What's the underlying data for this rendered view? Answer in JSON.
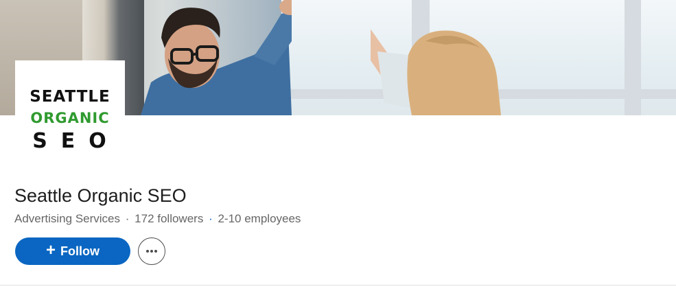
{
  "company": {
    "name": "Seattle Organic SEO",
    "industry": "Advertising Services",
    "separator": "·",
    "followers": "172 followers",
    "employees": "2-10 employees"
  },
  "logo": {
    "line1": "SEATTLE",
    "line2": "ORGANIC",
    "line3": "SEO"
  },
  "actions": {
    "follow_label": "Follow",
    "follow_icon": "plus-icon",
    "more_icon": "more-horizontal-icon"
  },
  "colors": {
    "primary": "#0a66c2",
    "text_primary": "#1d1d1d",
    "text_secondary": "#666666",
    "logo_green": "#2f9a2f"
  }
}
